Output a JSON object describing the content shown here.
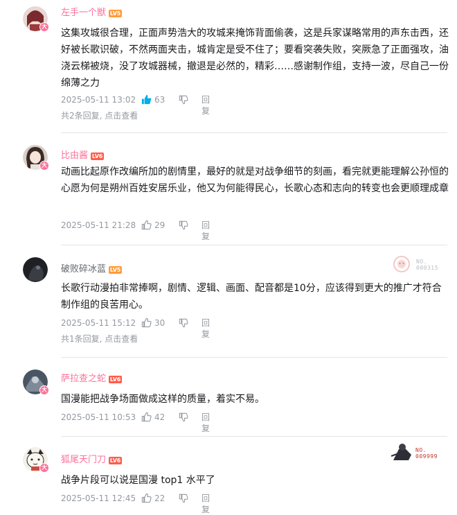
{
  "comments": [
    {
      "user": "左手一个獣",
      "level": "LV5",
      "text": "这集攻城很合理，正面声势浩大的攻城来掩饰背面偷袭，这是兵家谋略常用的声东击西，还好被长歌识破，不然两面夹击，城肯定是受不住了；要看突袭失败，突厥急了正面强攻，油浇云梯被烧，没了攻城器械，撤退是必然的，精彩……感谢制作组，支持一波，尽自己一份绵薄之力",
      "time": "2025-05-11 13:02",
      "likes": "63",
      "reply_label": "回复",
      "sub_replies": "共2条回复, 点击查看"
    },
    {
      "user": "比由酱",
      "level": "LV6",
      "text": "动画比起原作改编所加的剧情里，最好的就是对战争细节的刻画，看完就更能理解公孙恒的心愿为何是朔州百姓安居乐业，他又为何能得民心，长歌心态和志向的转变也会更顺理成章",
      "time": "2025-05-11 21:28",
      "likes": "29",
      "reply_label": "回复"
    },
    {
      "user": "破败碎冰蓝",
      "level": "LV5",
      "text": "长歌行动漫拍非常捧啊，剧情、逻辑、画面、配音都是10分，应该得到更大的推广才符合制作组的良苦用心。",
      "time": "2025-05-11 15:12",
      "likes": "30",
      "reply_label": "回复",
      "sub_replies": "共1条回复, 点击查看",
      "badge_number": "NO.\n000315"
    },
    {
      "user": "萨拉查之蛇",
      "level": "LV6",
      "text": "国漫能把战争场面做成这样的质量，着实不易。",
      "time": "2025-05-11 10:53",
      "likes": "42",
      "reply_label": "回复"
    },
    {
      "user": "狐尾天门刀",
      "level": "LV6",
      "text": "战争片段可以说是国漫 top1 水平了",
      "time": "2025-05-11 12:45",
      "likes": "22",
      "reply_label": "回复",
      "badge_number": "NO.\n009999"
    }
  ],
  "colors": {
    "pink": "#fb7299",
    "like_active": "#00aeec",
    "muted": "#9499a0",
    "lv5": "#ff9b3a",
    "lv6": "#ff5c4a"
  },
  "icons": {
    "vip_badge": "大",
    "like": "thumb-up-icon",
    "dislike": "thumb-down-icon"
  }
}
